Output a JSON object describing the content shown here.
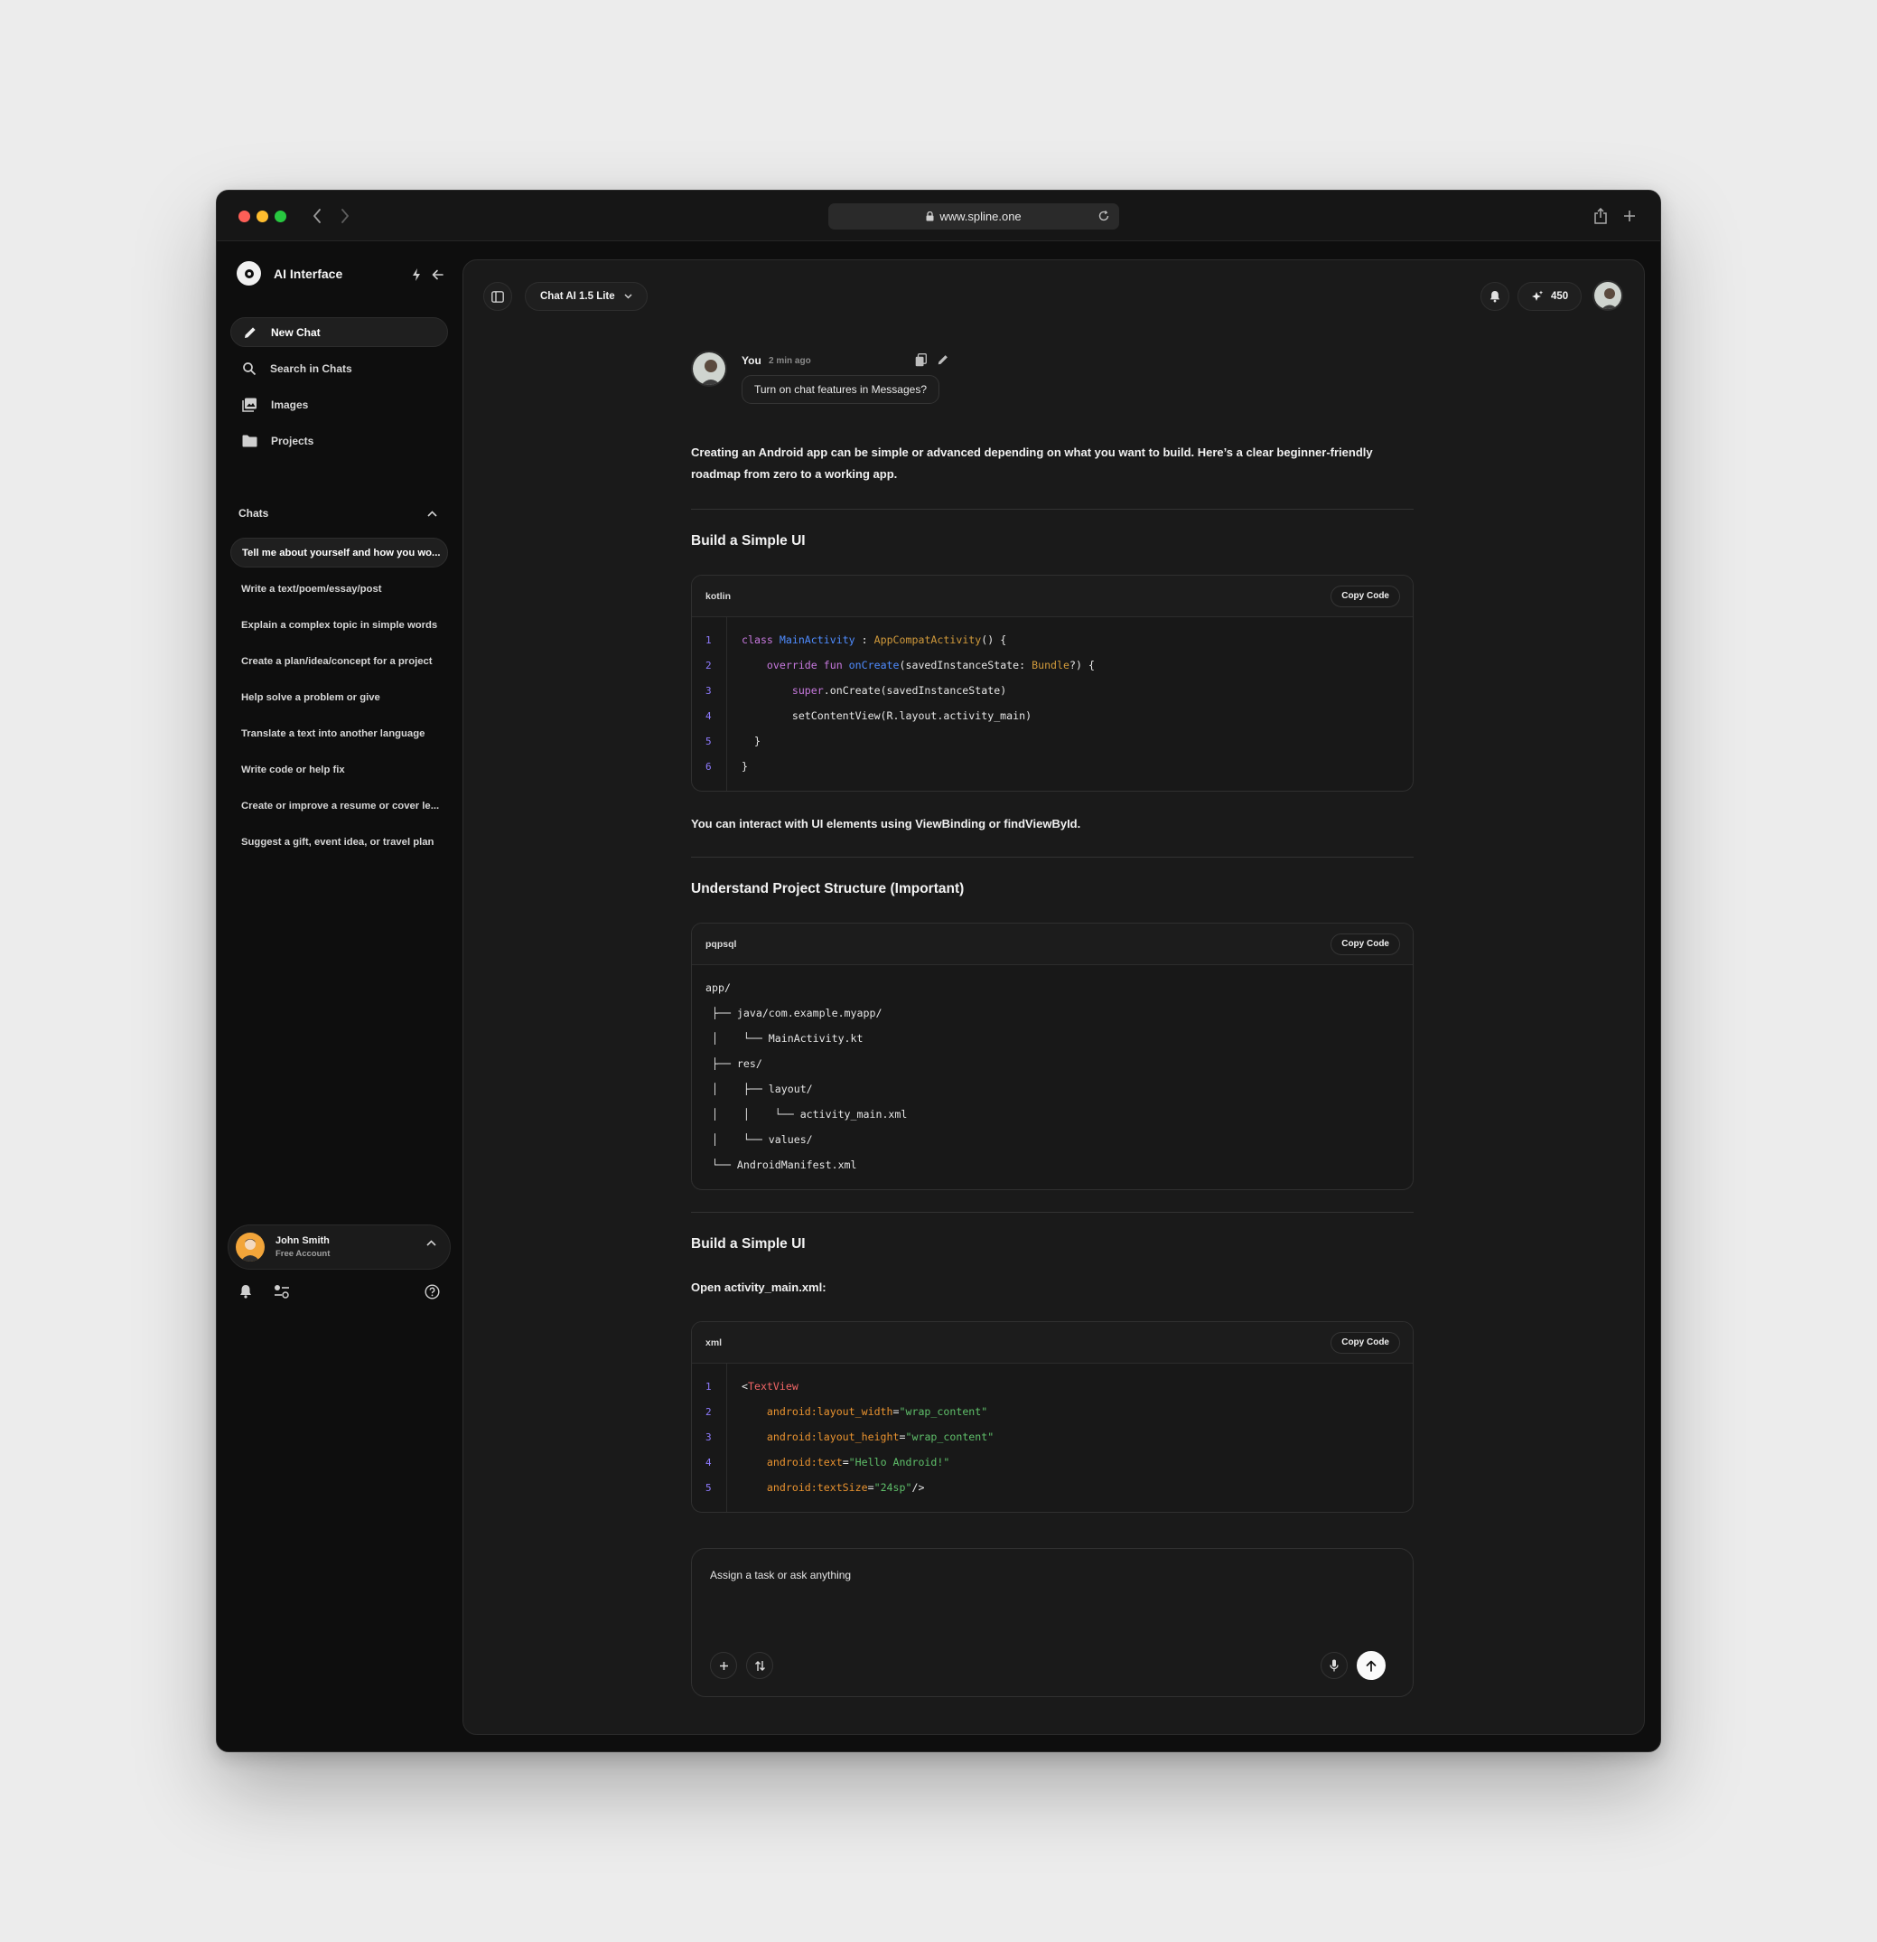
{
  "browser": {
    "url": "www.spline.one",
    "traffic_lights": [
      "#fe5f57",
      "#febc2e",
      "#28c840"
    ]
  },
  "sidebar": {
    "app_name": "AI Interface",
    "menu": [
      {
        "label": "New Chat",
        "icon": "pencil-icon"
      },
      {
        "label": "Search in Chats",
        "icon": "search-icon"
      },
      {
        "label": "Images",
        "icon": "images-icon"
      },
      {
        "label": "Projects",
        "icon": "folder-icon"
      }
    ],
    "chats_title": "Chats",
    "chats": [
      "Tell me about yourself and how you wo...",
      "Write a text/poem/essay/post",
      "Explain a complex topic in simple words",
      "Create a plan/idea/concept for a project",
      "Help solve a problem or give",
      "Translate a text into another language",
      "Write code or help fix",
      "Create or improve a resume or cover le...",
      "Suggest a gift, event idea, or travel plan"
    ],
    "account": {
      "name": "John Smith",
      "plan": "Free Account"
    }
  },
  "topbar": {
    "model": "Chat AI 1.5 Lite",
    "points": "450"
  },
  "conversation": {
    "user": {
      "name": "You",
      "time": "2 min ago",
      "message": "Turn on chat features in Messages?"
    },
    "intro": "Creating an Android app can be simple or advanced depending on what you want to build. Here’s a clear beginner-friendly roadmap from zero to a working app.",
    "section1_title": "Build a Simple UI",
    "code1_lang": "kotlin",
    "copy_label": "Copy Code",
    "para1": "You can interact with UI elements using ViewBinding or findViewById.",
    "section2_title": "Understand Project Structure (Important)",
    "code2_lang": "pqpsql",
    "tree": [
      "app/",
      " ├── java/com.example.myapp/",
      " │    └── MainActivity.kt",
      " ├── res/",
      " │    ├── layout/",
      " │    │    └── activity_main.xml",
      " │    └── values/",
      " └── AndroidManifest.xml"
    ],
    "section3_title": "Build a Simple UI",
    "para2": "Open activity_main.xml:",
    "code3_lang": "xml"
  },
  "composer": {
    "placeholder": "Assign a task or ask anything"
  }
}
